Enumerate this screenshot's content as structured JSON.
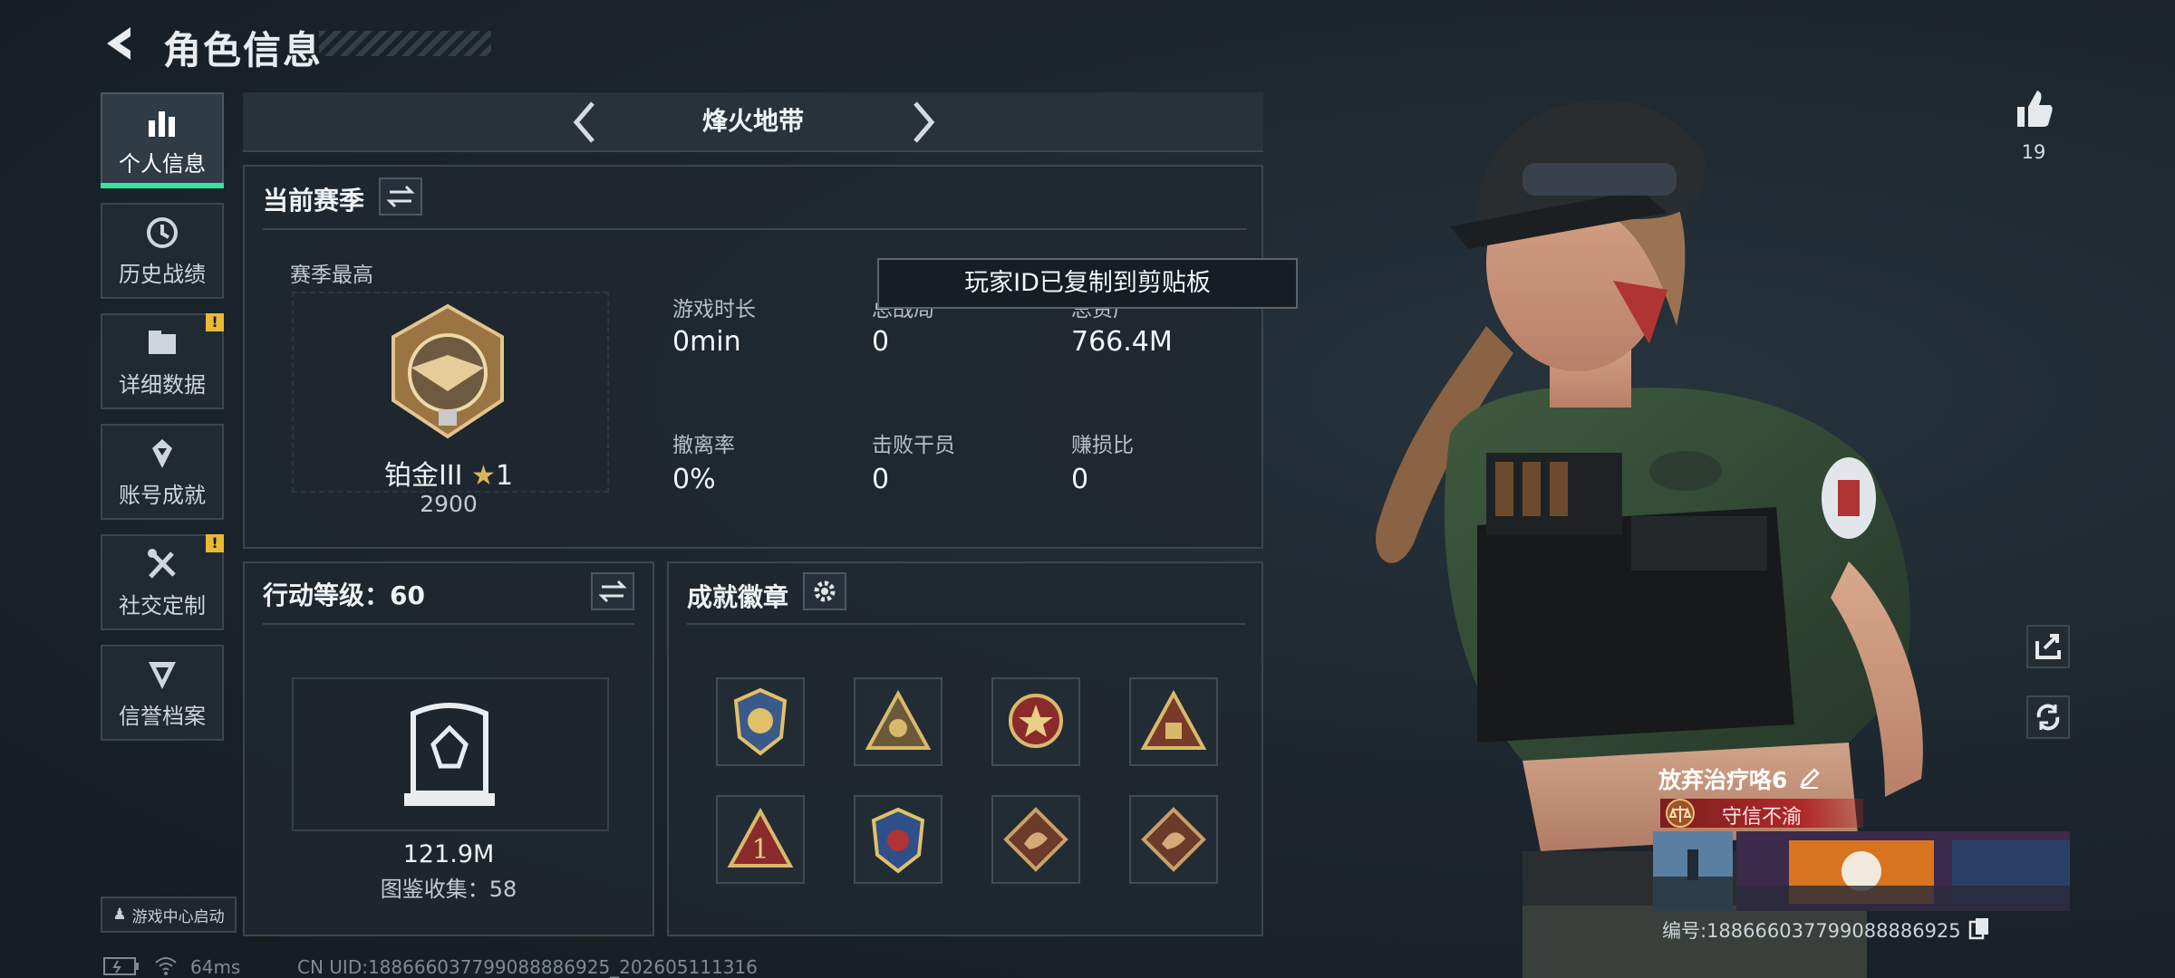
{
  "header": {
    "title": "角色信息"
  },
  "sidebar": {
    "items": [
      {
        "label": "个人信息",
        "icon": "bar-chart-icon",
        "active": true
      },
      {
        "label": "历史战绩",
        "icon": "history-clock-icon"
      },
      {
        "label": "详细数据",
        "icon": "folder-icon",
        "alert": "!"
      },
      {
        "label": "账号成就",
        "icon": "achievement-icon"
      },
      {
        "label": "社交定制",
        "icon": "tools-icon",
        "alert": "!"
      },
      {
        "label": "信誉档案",
        "icon": "reputation-icon"
      }
    ],
    "launch_label": "游戏中心启动"
  },
  "mode": {
    "name": "烽火地带"
  },
  "season": {
    "title": "当前赛季",
    "best_label": "赛季最高",
    "rank_name": "铂金III",
    "rank_stars": "1",
    "rank_score": "2900",
    "stats": [
      {
        "label": "游戏时长",
        "value": "0min"
      },
      {
        "label": "总战局",
        "value": "0"
      },
      {
        "label": "总资产",
        "value": "766.4M"
      },
      {
        "label": "撤离率",
        "value": "0%"
      },
      {
        "label": "击败干员",
        "value": "0"
      },
      {
        "label": "赚损比",
        "value": "0"
      }
    ]
  },
  "toast": "玩家ID已复制到剪贴板",
  "action_level": {
    "title": "行动等级：60",
    "value": "121.9M",
    "collection": "图鉴收集：58"
  },
  "achievements": {
    "title": "成就徽章",
    "badges": [
      "badge-shield",
      "badge-triangle-team",
      "badge-star-round",
      "badge-triangle-box",
      "badge-triangle-one",
      "badge-blue-shield",
      "badge-dragon",
      "badge-dragon-2"
    ]
  },
  "profile": {
    "likes": "19",
    "name": "放弃治疗咯6",
    "title_tag": "守信不渝",
    "number": "编号:18866603779908888692​5"
  },
  "footer": {
    "ping": "64ms",
    "uid": "CN UID:1886660377990888869​25_202605111316"
  },
  "colors": {
    "accent": "#39e29a",
    "warn": "#e9b933",
    "title_red": "#b12828"
  }
}
